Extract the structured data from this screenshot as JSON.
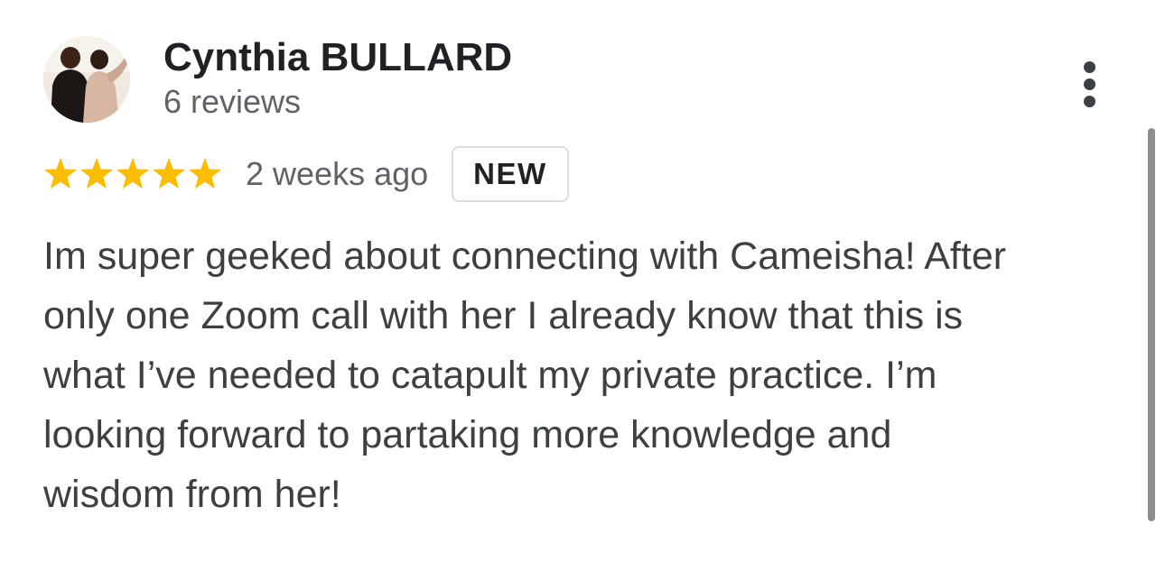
{
  "review": {
    "author_name": "Cynthia BULLARD",
    "review_count": "6 reviews",
    "rating": 5,
    "rating_max": 5,
    "date": "2 weeks ago",
    "badge": "NEW",
    "text": "Im super geeked about connecting with Cameisha! After\nonly one Zoom call with her I already know that this is\nwhat I’ve needed to catapult my private practice. I’m\nlooking forward to partaking more knowledge and\nwisdom from her!"
  },
  "icons": {
    "avatar": "profile-photo",
    "more": "more-vertical-icon",
    "star": "star-icon"
  },
  "colors": {
    "star": "#fbbc04",
    "name": "#202124",
    "secondary_text": "#5f6368",
    "body_text": "#3c4043",
    "badge_border": "#dadce0",
    "scrollbar": "#8e8e8e"
  }
}
